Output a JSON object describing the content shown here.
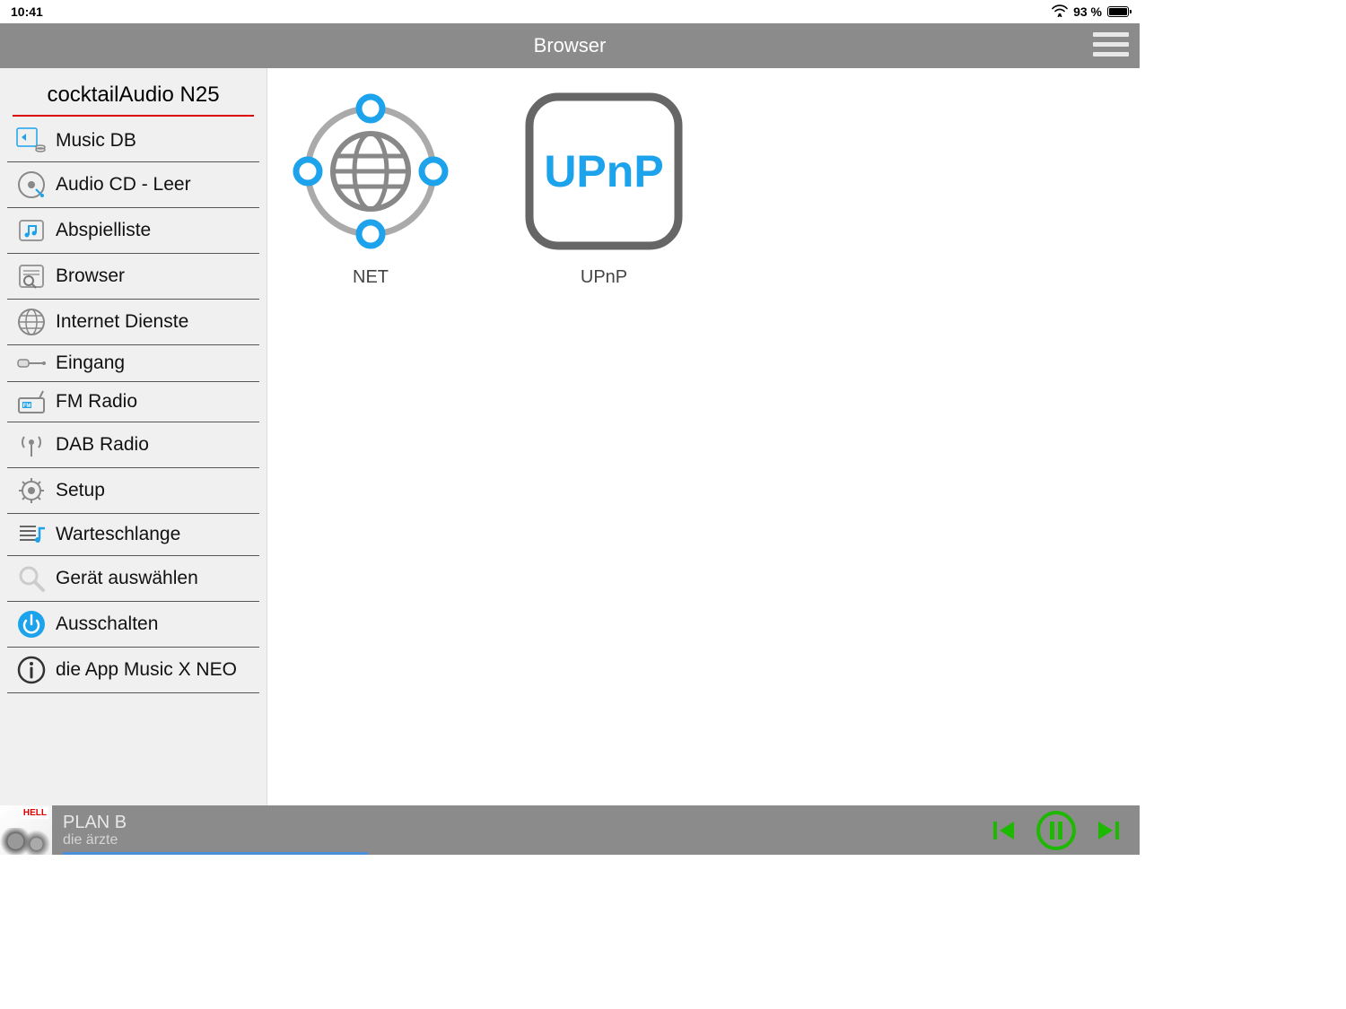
{
  "status": {
    "time": "10:41",
    "battery_pct": "93 %"
  },
  "header": {
    "title": "Browser"
  },
  "sidebar": {
    "device_name": "cocktailAudio N25",
    "items": [
      {
        "icon": "music-db-icon",
        "label": "Music DB"
      },
      {
        "icon": "cd-icon",
        "label": "Audio CD - Leer"
      },
      {
        "icon": "playlist-icon",
        "label": "Abspielliste"
      },
      {
        "icon": "browser-icon",
        "label": "Browser"
      },
      {
        "icon": "globe-icon",
        "label": "Internet Dienste"
      },
      {
        "icon": "input-icon",
        "label": "Eingang"
      },
      {
        "icon": "fm-radio-icon",
        "label": "FM Radio"
      },
      {
        "icon": "dab-radio-icon",
        "label": "DAB Radio"
      },
      {
        "icon": "gear-icon",
        "label": "Setup"
      },
      {
        "icon": "queue-icon",
        "label": "Warteschlange"
      },
      {
        "icon": "search-icon",
        "label": "Gerät auswählen"
      },
      {
        "icon": "power-icon",
        "label": "Ausschalten"
      },
      {
        "icon": "info-icon",
        "label": "die App Music X NEO"
      }
    ]
  },
  "browser": {
    "items": [
      {
        "name": "net",
        "caption": "NET"
      },
      {
        "name": "upnp",
        "caption": "UPnP"
      }
    ],
    "upnp_label": "UPnP"
  },
  "player": {
    "track_title": "PLAN B",
    "track_artist": "die ärzte",
    "album_badge": "HELL"
  },
  "colors": {
    "accent": "#1ca3ec",
    "play_green": "#1db800"
  }
}
